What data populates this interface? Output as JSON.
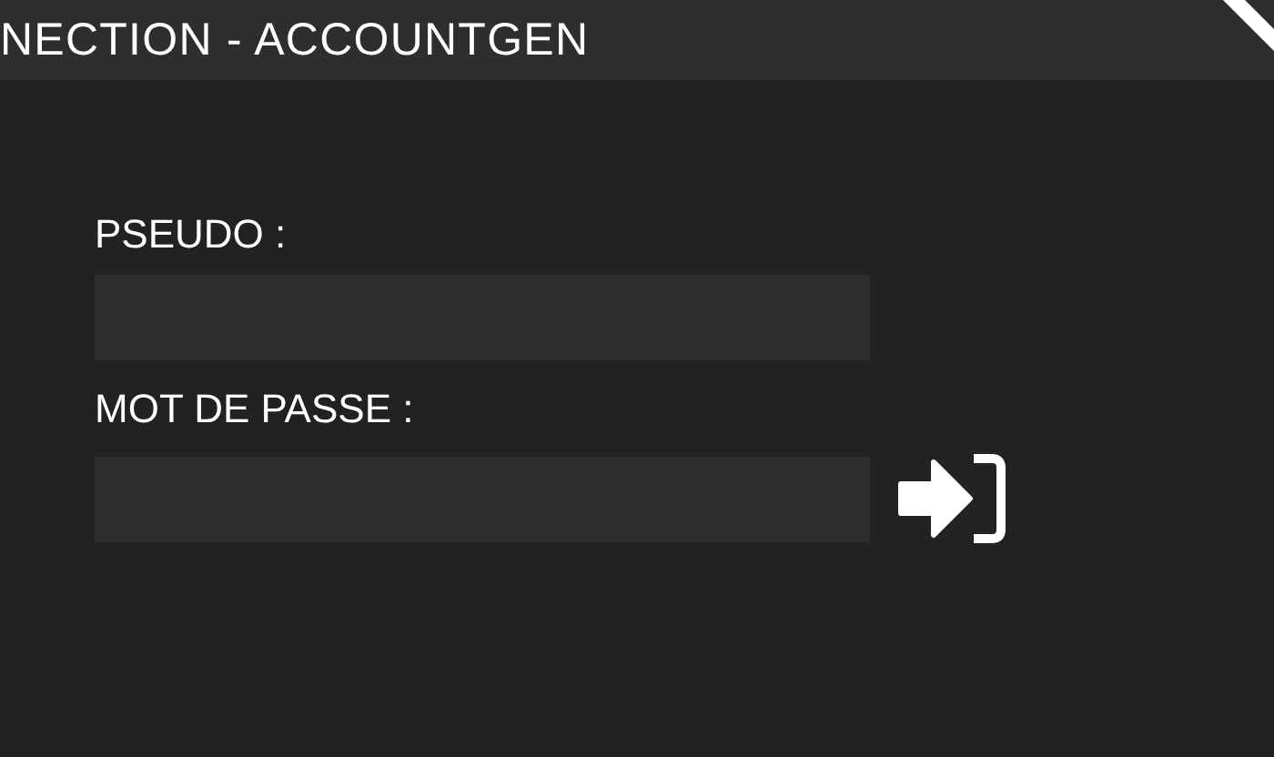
{
  "window": {
    "title": "NECTION - ACCOUNTGEN"
  },
  "fields": [
    {
      "label": "PSEUDO :",
      "kind": "text"
    },
    {
      "label": "MOT DE PASSE :",
      "kind": "password"
    }
  ]
}
